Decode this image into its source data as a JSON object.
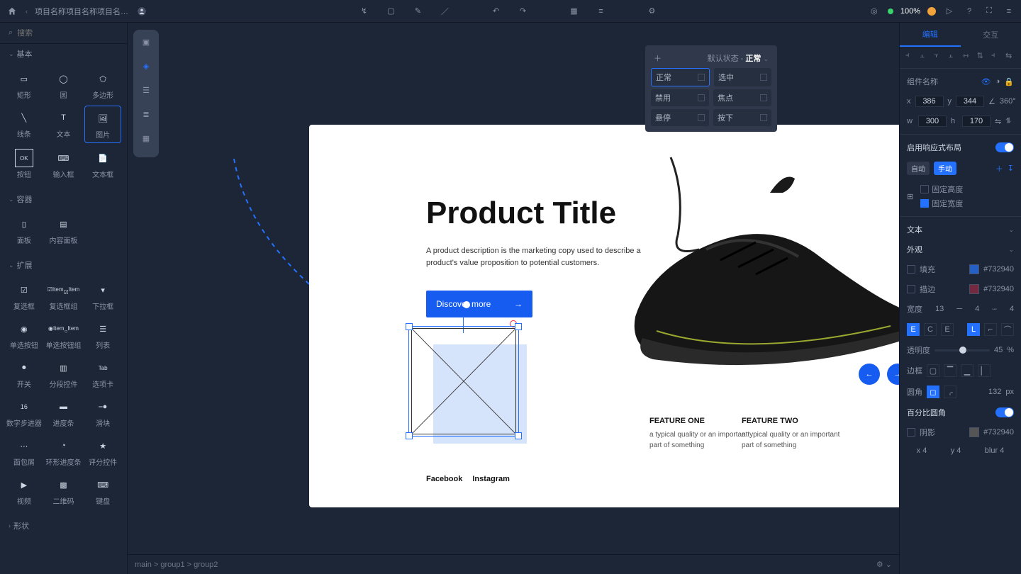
{
  "project_tab": "项目名称项目名称项目名…",
  "zoom": "100%",
  "search_placeholder": "搜索",
  "sections": {
    "basic": "基本",
    "container": "容器",
    "expand": "扩展",
    "shape": "形状"
  },
  "tools": {
    "rect": "矩形",
    "circle": "圆",
    "polygon": "多边形",
    "line": "线条",
    "text": "文本",
    "image": "图片",
    "button": "按钮",
    "input": "输入框",
    "textbox": "文本框",
    "panel": "面板",
    "contentpanel": "内容面板",
    "checkbox": "复选框",
    "checkboxgroup": "复选框组",
    "dropdown": "下拉框",
    "radio": "单选按钮",
    "radiogroup": "单选按钮组",
    "list": "列表",
    "switch": "开关",
    "stepper": "分段控件",
    "tabs": "选项卡",
    "number": "数字步进器",
    "progress": "进度条",
    "slider": "滑块",
    "breadcrumb": "面包屑",
    "ring": "环形进度条",
    "rating": "评分控件",
    "video": "视频",
    "qr": "二维码",
    "keyboard": "键盘"
  },
  "checkbox_item": "Item",
  "ok_label": "OK",
  "artboard": {
    "title": "Product Title",
    "desc": "A product description is the marketing copy used to describe a product's value proposition to potential customers.",
    "cta": "Discover more",
    "feature1": {
      "t": "FEATURE ONE",
      "d": "a typical quality or an important part of something"
    },
    "feature2": {
      "t": "FEATURE TWO",
      "d": "a typical quality or an important part of something"
    },
    "social1": "Facebook",
    "social2": "Instagram"
  },
  "breadcrumb": "main > group1 > group2",
  "state_popover": {
    "default_label": "默认状态 - ",
    "default_val": "正常",
    "normal": "正常",
    "selected": "选中",
    "disabled": "禁用",
    "focus": "焦点",
    "hover": "悬停",
    "pressed": "按下"
  },
  "right": {
    "tab_edit": "编辑",
    "tab_interact": "交互",
    "comp_name": "组件名称",
    "x": "386",
    "y": "344",
    "angle": "360°",
    "w": "300",
    "h": "170",
    "resp": "启用响应式布局",
    "auto": "自动",
    "manual": "手动",
    "fixed_h": "固定高度",
    "fixed_w": "固定宽度",
    "sec_text": "文本",
    "sec_appearance": "外观",
    "fill": "填充",
    "stroke": "描边",
    "stroke_color": "#732940",
    "fill_color": "#732940",
    "opacity": "透明度",
    "opacity_val": "45",
    "pct": "%",
    "border": "边框",
    "radius": "132",
    "px": "px",
    "pct_radius": "百分比圆角",
    "shadow": "阴影",
    "x2": "4",
    "y2": "4",
    "blur": "blur 4",
    "wl": "宽度",
    "xl": "x",
    "yl": "y",
    "al": "圆角",
    "el": "描边",
    "val_13": "13"
  }
}
